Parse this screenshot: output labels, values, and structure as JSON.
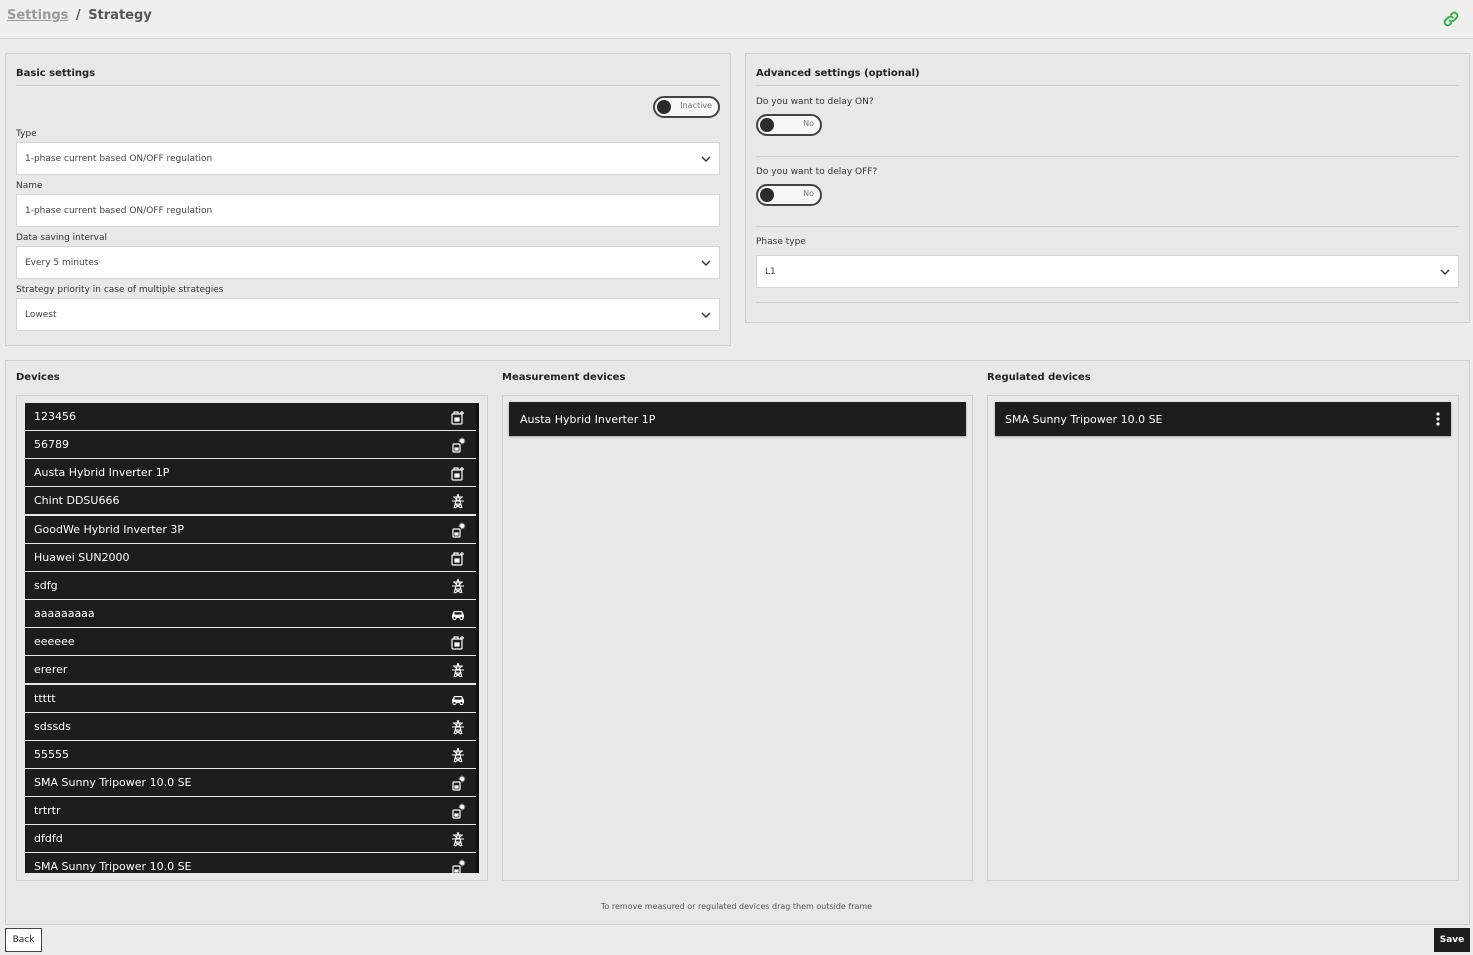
{
  "breadcrumb": {
    "parent": "Settings",
    "separator": "/",
    "current": "Strategy"
  },
  "colors": {
    "accent_green": "#2bb34a",
    "dark_item": "#1d1d1d"
  },
  "basic": {
    "title": "Basic settings",
    "status_toggle": "Inactive",
    "type_label": "Type",
    "type_value": "1-phase current based ON/OFF regulation",
    "name_label": "Name",
    "name_value": "1-phase current based ON/OFF regulation",
    "interval_label": "Data saving interval",
    "interval_value": "Every 5 minutes",
    "priority_label": "Strategy priority in case of multiple strategies",
    "priority_value": "Lowest"
  },
  "advanced": {
    "title": "Advanced settings (optional)",
    "delay_on_label": "Do you want to delay ON?",
    "delay_on_value": "No",
    "delay_off_label": "Do you want to delay OFF?",
    "delay_off_value": "No",
    "phase_label": "Phase type",
    "phase_value": "L1"
  },
  "devices": {
    "title": "Devices",
    "items": [
      {
        "name": "123456",
        "icon": "inverter-icon"
      },
      {
        "name": "56789",
        "icon": "solar-inverter-icon"
      },
      {
        "name": "Austa Hybrid Inverter 1P",
        "icon": "inverter-icon"
      },
      {
        "name": "Chint DDSU666",
        "icon": "grid-tower-icon"
      },
      {
        "name": "GoodWe Hybrid Inverter 3P",
        "icon": "solar-inverter-icon"
      },
      {
        "name": "Huawei SUN2000",
        "icon": "inverter-icon"
      },
      {
        "name": "sdfg",
        "icon": "grid-tower-icon"
      },
      {
        "name": "aaaaaaaaa",
        "icon": "car-icon"
      },
      {
        "name": "eeeeee",
        "icon": "inverter-icon"
      },
      {
        "name": "ererer",
        "icon": "grid-tower-icon"
      },
      {
        "name": "ttttt",
        "icon": "car-icon"
      },
      {
        "name": "sdssds",
        "icon": "grid-tower-icon"
      },
      {
        "name": "55555",
        "icon": "grid-tower-icon"
      },
      {
        "name": "SMA Sunny Tripower 10.0 SE",
        "icon": "solar-inverter-icon"
      },
      {
        "name": "trtrtr",
        "icon": "solar-inverter-icon"
      },
      {
        "name": "dfdfd",
        "icon": "grid-tower-icon"
      },
      {
        "name": "SMA Sunny Tripower 10.0 SE",
        "icon": "solar-inverter-icon"
      }
    ]
  },
  "measurement": {
    "title": "Measurement devices",
    "items": [
      "Austa Hybrid Inverter 1P"
    ]
  },
  "regulated": {
    "title": "Regulated devices",
    "items": [
      "SMA Sunny Tripower 10.0 SE"
    ]
  },
  "hint": "To remove measured or regulated devices drag them outside frame",
  "actions": {
    "back": "Back",
    "save": "Save"
  }
}
